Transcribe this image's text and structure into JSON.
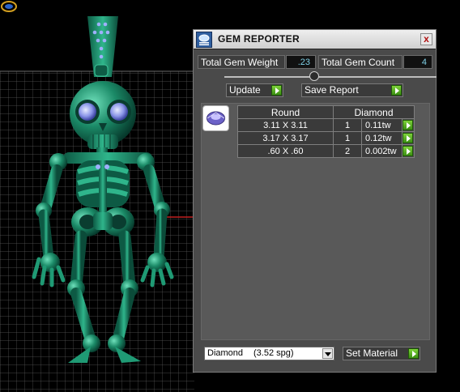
{
  "panel": {
    "title": "GEM REPORTER",
    "close_glyph": "x",
    "total_weight_label": "Total Gem Weight",
    "total_weight_value": ".23",
    "total_count_label": "Total Gem Count",
    "total_count_value": "4",
    "update_label": "Update",
    "save_report_label": "Save Report",
    "table": {
      "headers": [
        "Round",
        "Diamond"
      ],
      "rows": [
        {
          "size": "3.11 X 3.11",
          "qty": "1",
          "weight": "0.11tw"
        },
        {
          "size": "3.17 X 3.17",
          "qty": "1",
          "weight": "0.12tw"
        },
        {
          "size": ".60 X .60",
          "qty": "2",
          "weight": "0.002tw"
        }
      ]
    },
    "material_select": {
      "value": "Diamond",
      "detail": "(3.52 spg)"
    },
    "set_material_label": "Set Material"
  },
  "icons": {
    "app": "gem-reporter-icon",
    "close": "close-icon",
    "go": "green-arrow-icon",
    "gem": "round-gem-icon",
    "dropdown": "chevron-down-icon"
  },
  "colors": {
    "panel_bg": "#4a4a4a",
    "model": "#1a8a68",
    "accent_green": "#5db022",
    "value_text": "#7fd0e6"
  }
}
